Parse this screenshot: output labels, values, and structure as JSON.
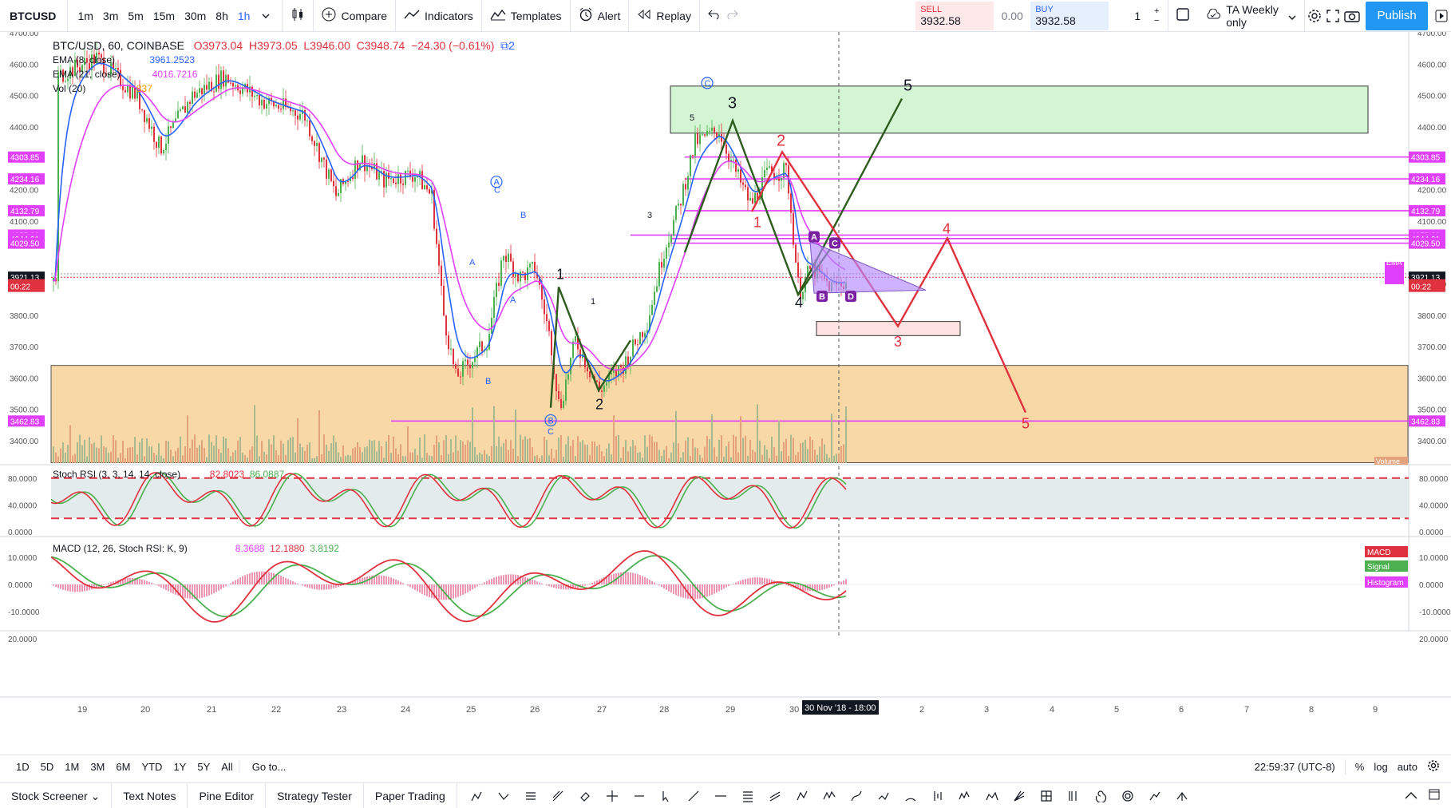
{
  "toolbar": {
    "symbol": "BTCUSD",
    "intervals": [
      "1m",
      "3m",
      "5m",
      "15m",
      "30m",
      "8h",
      "1h"
    ],
    "active_interval": "1h",
    "compare_label": "Compare",
    "indicators_label": "Indicators",
    "templates_label": "Templates",
    "alert_label": "Alert",
    "replay_label": "Replay",
    "sell_label": "SELL",
    "sell_price": "3932.58",
    "spread": "0.00",
    "buy_label": "BUY",
    "buy_price": "3932.58",
    "quantity": "1",
    "layout_name": "TA Weekly only",
    "publish_label": "Publish",
    "colors": {
      "accent": "#2962ff",
      "sell": "#e0313e",
      "publish": "#2196f3"
    }
  },
  "legend": {
    "title": "BTC/USD, 60, COINBASE",
    "open": "O3973.04",
    "high": "H3973.05",
    "low": "L3946.00",
    "close": "C3948.74",
    "change": "−24.30 (−0.61%)",
    "ideas_count": "2",
    "ema8_label": "EMA (8, close)",
    "ema8_value": "3961.2523",
    "ema21_label": "EMA (21, close)",
    "ema21_value": "4016.7216",
    "vol_label": "Vol (20)",
    "vol_value": "837",
    "stoch_label": "Stoch RSI (3, 3, 14, 14, close)",
    "stoch_k": "82.8023",
    "stoch_d": "86.0887",
    "macd_label": "MACD (12, 26, Stoch RSI: K, 9)",
    "macd_hist": "8.3688",
    "macd_line": "12.1880",
    "macd_signal": "3.8192"
  },
  "price_axis": {
    "ticks": [
      "4700.00",
      "4600.00",
      "4500.00",
      "4400.00",
      "4200.00",
      "4100.00",
      "3900.00",
      "3800.00",
      "3700.00",
      "3600.00",
      "3500.00",
      "3400.00"
    ],
    "tags": [
      {
        "v": "4303.85",
        "color": "#e040fb"
      },
      {
        "v": "4234.16",
        "color": "#e040fb"
      },
      {
        "v": "4132.79",
        "color": "#e040fb"
      },
      {
        "v": "4055.30",
        "color": "#e040fb"
      },
      {
        "v": "4044.01",
        "color": "#e040fb"
      },
      {
        "v": "4029.50",
        "color": "#e040fb"
      },
      {
        "v": "3921.13",
        "color": "#131722"
      },
      {
        "v": "3932.58",
        "color": "#e0313e"
      },
      {
        "v": "00:22",
        "color": "#e0313e"
      },
      {
        "v": "3462.83",
        "color": "#e040fb"
      }
    ],
    "stoch_ticks": [
      "80.0000",
      "40.0000",
      "0.0000"
    ],
    "macd_ticks": [
      "10.0000",
      "0.0000",
      "-10.0000",
      "20.0000"
    ],
    "macd_tags": [
      "MACD",
      "Signal",
      "Histogram"
    ],
    "ema_tag": "EMA",
    "volume_tag": "Volume"
  },
  "time_axis": {
    "labels": [
      "19",
      "20",
      "21",
      "22",
      "23",
      "24",
      "25",
      "26",
      "27",
      "28",
      "29",
      "30",
      "2",
      "3",
      "4",
      "5",
      "6",
      "7",
      "8",
      "9"
    ],
    "crosshair_label": "30 Nov '18 - 18:00"
  },
  "wave_labels": {
    "circle_c": "C",
    "three": "3",
    "five_small": "5",
    "five": "5",
    "two_red": "2",
    "one_red": "1",
    "four_red": "4",
    "three_red": "3",
    "five_red": "5",
    "four_green": "4",
    "one_green": "1",
    "two_green": "2",
    "one_small": "1",
    "three_small": "3",
    "a_circle": "A",
    "b_circle": "B",
    "c_letter": "C",
    "b_letter": "B",
    "a_letter": "A",
    "pat_a": "A",
    "pat_b": "B",
    "pat_c": "C",
    "pat_d": "D"
  },
  "rangebar": {
    "ranges": [
      "1D",
      "5D",
      "1M",
      "3M",
      "6M",
      "YTD",
      "1Y",
      "5Y",
      "All"
    ],
    "goto": "Go to...",
    "clock": "22:59:37 (UTC-8)",
    "pct": "%",
    "log": "log",
    "auto": "auto"
  },
  "bottombar": {
    "tabs": [
      "Stock Screener",
      "Text Notes",
      "Pine Editor",
      "Strategy Tester",
      "Paper Trading"
    ]
  }
}
